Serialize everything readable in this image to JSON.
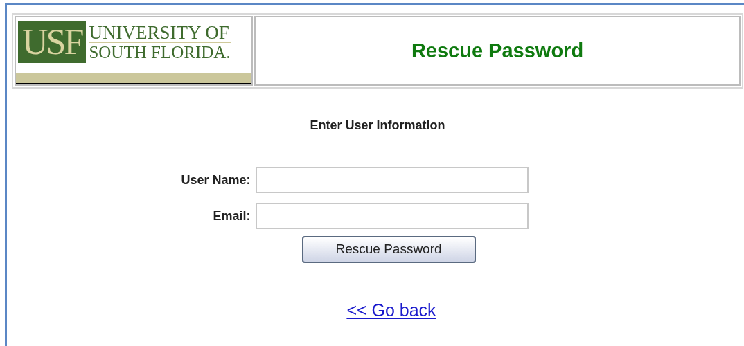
{
  "logo": {
    "mark": "USF",
    "line_1": "UNIVERSITY OF",
    "line_2": "SOUTH FLORIDA."
  },
  "title": "Rescue Password",
  "form": {
    "heading": "Enter User Information",
    "fields": [
      {
        "label": "User Name:"
      },
      {
        "label": "Email:"
      }
    ],
    "submit": "Rescue Password"
  },
  "back_link": "<< Go back"
}
